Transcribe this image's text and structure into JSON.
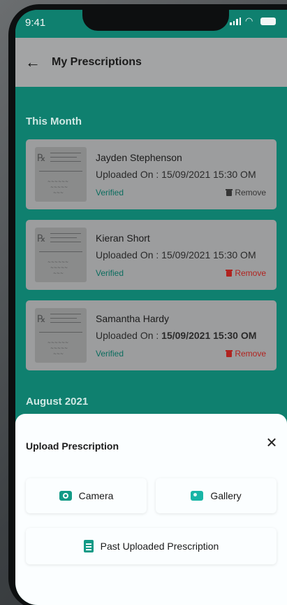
{
  "status": {
    "time": "9:41"
  },
  "header": {
    "title": "My Prescriptions"
  },
  "sections": [
    {
      "title": "This Month"
    },
    {
      "title": "August 2021"
    }
  ],
  "cards": [
    {
      "name": "Jayden Stephenson",
      "uploaded_label": "Uploaded On : 15/09/2021 15:30 OM",
      "status": "Verified",
      "remove": "Remove"
    },
    {
      "name": "Kieran Short",
      "uploaded_label": "Uploaded On : 15/09/2021 15:30 OM",
      "status": "Verified",
      "remove": "Remove"
    },
    {
      "name": "Samantha Hardy",
      "uploaded_prefix": "Uploaded On : ",
      "uploaded_value": "15/09/2021 15:30 OM",
      "status": "Verified",
      "remove": "Remove"
    }
  ],
  "sheet": {
    "title": "Upload Prescription",
    "options": {
      "camera": "Camera",
      "gallery": "Gallery",
      "past": "Past Uploaded Prescription"
    }
  },
  "colors": {
    "accent": "#129a86",
    "remove_red": "#b0231f"
  }
}
